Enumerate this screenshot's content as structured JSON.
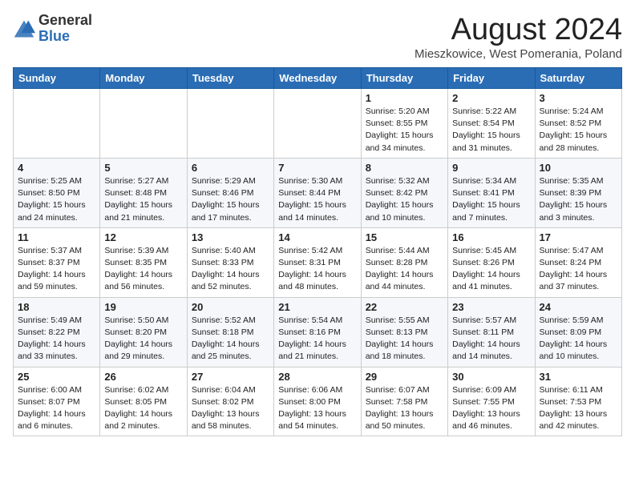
{
  "header": {
    "logo_general": "General",
    "logo_blue": "Blue",
    "title": "August 2024",
    "location": "Mieszkowice, West Pomerania, Poland"
  },
  "weekdays": [
    "Sunday",
    "Monday",
    "Tuesday",
    "Wednesday",
    "Thursday",
    "Friday",
    "Saturday"
  ],
  "weeks": [
    [
      {
        "day": "",
        "info": ""
      },
      {
        "day": "",
        "info": ""
      },
      {
        "day": "",
        "info": ""
      },
      {
        "day": "",
        "info": ""
      },
      {
        "day": "1",
        "info": "Sunrise: 5:20 AM\nSunset: 8:55 PM\nDaylight: 15 hours\nand 34 minutes."
      },
      {
        "day": "2",
        "info": "Sunrise: 5:22 AM\nSunset: 8:54 PM\nDaylight: 15 hours\nand 31 minutes."
      },
      {
        "day": "3",
        "info": "Sunrise: 5:24 AM\nSunset: 8:52 PM\nDaylight: 15 hours\nand 28 minutes."
      }
    ],
    [
      {
        "day": "4",
        "info": "Sunrise: 5:25 AM\nSunset: 8:50 PM\nDaylight: 15 hours\nand 24 minutes."
      },
      {
        "day": "5",
        "info": "Sunrise: 5:27 AM\nSunset: 8:48 PM\nDaylight: 15 hours\nand 21 minutes."
      },
      {
        "day": "6",
        "info": "Sunrise: 5:29 AM\nSunset: 8:46 PM\nDaylight: 15 hours\nand 17 minutes."
      },
      {
        "day": "7",
        "info": "Sunrise: 5:30 AM\nSunset: 8:44 PM\nDaylight: 15 hours\nand 14 minutes."
      },
      {
        "day": "8",
        "info": "Sunrise: 5:32 AM\nSunset: 8:42 PM\nDaylight: 15 hours\nand 10 minutes."
      },
      {
        "day": "9",
        "info": "Sunrise: 5:34 AM\nSunset: 8:41 PM\nDaylight: 15 hours\nand 7 minutes."
      },
      {
        "day": "10",
        "info": "Sunrise: 5:35 AM\nSunset: 8:39 PM\nDaylight: 15 hours\nand 3 minutes."
      }
    ],
    [
      {
        "day": "11",
        "info": "Sunrise: 5:37 AM\nSunset: 8:37 PM\nDaylight: 14 hours\nand 59 minutes."
      },
      {
        "day": "12",
        "info": "Sunrise: 5:39 AM\nSunset: 8:35 PM\nDaylight: 14 hours\nand 56 minutes."
      },
      {
        "day": "13",
        "info": "Sunrise: 5:40 AM\nSunset: 8:33 PM\nDaylight: 14 hours\nand 52 minutes."
      },
      {
        "day": "14",
        "info": "Sunrise: 5:42 AM\nSunset: 8:31 PM\nDaylight: 14 hours\nand 48 minutes."
      },
      {
        "day": "15",
        "info": "Sunrise: 5:44 AM\nSunset: 8:28 PM\nDaylight: 14 hours\nand 44 minutes."
      },
      {
        "day": "16",
        "info": "Sunrise: 5:45 AM\nSunset: 8:26 PM\nDaylight: 14 hours\nand 41 minutes."
      },
      {
        "day": "17",
        "info": "Sunrise: 5:47 AM\nSunset: 8:24 PM\nDaylight: 14 hours\nand 37 minutes."
      }
    ],
    [
      {
        "day": "18",
        "info": "Sunrise: 5:49 AM\nSunset: 8:22 PM\nDaylight: 14 hours\nand 33 minutes."
      },
      {
        "day": "19",
        "info": "Sunrise: 5:50 AM\nSunset: 8:20 PM\nDaylight: 14 hours\nand 29 minutes."
      },
      {
        "day": "20",
        "info": "Sunrise: 5:52 AM\nSunset: 8:18 PM\nDaylight: 14 hours\nand 25 minutes."
      },
      {
        "day": "21",
        "info": "Sunrise: 5:54 AM\nSunset: 8:16 PM\nDaylight: 14 hours\nand 21 minutes."
      },
      {
        "day": "22",
        "info": "Sunrise: 5:55 AM\nSunset: 8:13 PM\nDaylight: 14 hours\nand 18 minutes."
      },
      {
        "day": "23",
        "info": "Sunrise: 5:57 AM\nSunset: 8:11 PM\nDaylight: 14 hours\nand 14 minutes."
      },
      {
        "day": "24",
        "info": "Sunrise: 5:59 AM\nSunset: 8:09 PM\nDaylight: 14 hours\nand 10 minutes."
      }
    ],
    [
      {
        "day": "25",
        "info": "Sunrise: 6:00 AM\nSunset: 8:07 PM\nDaylight: 14 hours\nand 6 minutes."
      },
      {
        "day": "26",
        "info": "Sunrise: 6:02 AM\nSunset: 8:05 PM\nDaylight: 14 hours\nand 2 minutes."
      },
      {
        "day": "27",
        "info": "Sunrise: 6:04 AM\nSunset: 8:02 PM\nDaylight: 13 hours\nand 58 minutes."
      },
      {
        "day": "28",
        "info": "Sunrise: 6:06 AM\nSunset: 8:00 PM\nDaylight: 13 hours\nand 54 minutes."
      },
      {
        "day": "29",
        "info": "Sunrise: 6:07 AM\nSunset: 7:58 PM\nDaylight: 13 hours\nand 50 minutes."
      },
      {
        "day": "30",
        "info": "Sunrise: 6:09 AM\nSunset: 7:55 PM\nDaylight: 13 hours\nand 46 minutes."
      },
      {
        "day": "31",
        "info": "Sunrise: 6:11 AM\nSunset: 7:53 PM\nDaylight: 13 hours\nand 42 minutes."
      }
    ]
  ]
}
